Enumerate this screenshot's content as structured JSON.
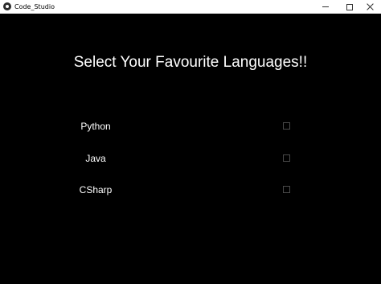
{
  "window": {
    "title": "Code_Studio",
    "app_icon": "kivy-app-icon",
    "controls": [
      "minimize",
      "maximize",
      "close"
    ]
  },
  "main": {
    "heading": "Select Your Favourite Languages!!",
    "languages": [
      {
        "label": "Python",
        "checked": false
      },
      {
        "label": "Java",
        "checked": false
      },
      {
        "label": "CSharp",
        "checked": false
      }
    ]
  },
  "colors": {
    "background": "#000000",
    "text": "#ffffff",
    "checkbox_border": "#4a4a4a",
    "titlebar": "#ffffff"
  }
}
